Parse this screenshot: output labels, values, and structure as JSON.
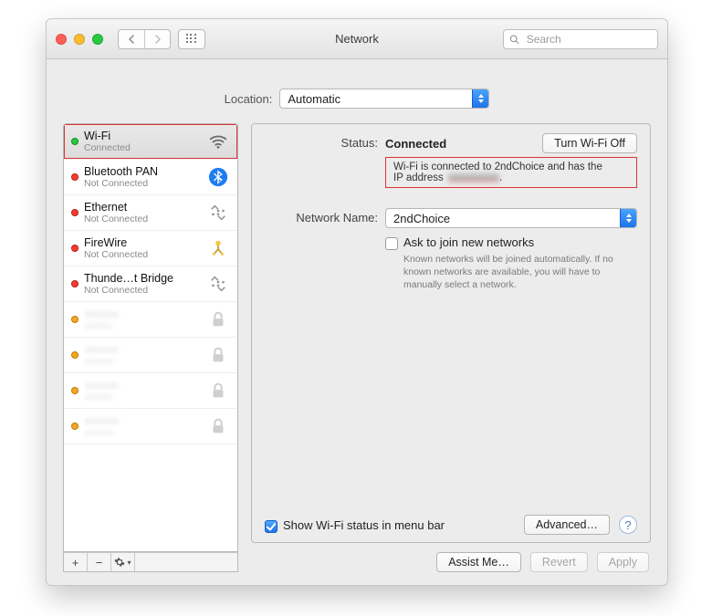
{
  "window": {
    "title": "Network"
  },
  "toolbar": {
    "search_placeholder": "Search"
  },
  "location": {
    "label": "Location:",
    "value": "Automatic"
  },
  "sidebar": {
    "items": [
      {
        "name": "Wi-Fi",
        "status": "Connected",
        "dot": "green",
        "icon": "wifi",
        "selected": true,
        "outlined": true
      },
      {
        "name": "Bluetooth PAN",
        "status": "Not Connected",
        "dot": "red",
        "icon": "bluetooth"
      },
      {
        "name": "Ethernet",
        "status": "Not Connected",
        "dot": "red",
        "icon": "ethernet"
      },
      {
        "name": "FireWire",
        "status": "Not Connected",
        "dot": "red",
        "icon": "firewire"
      },
      {
        "name": "Thunde…t Bridge",
        "status": "Not Connected",
        "dot": "red",
        "icon": "ethernet"
      },
      {
        "name": "———",
        "status": "———",
        "dot": "yellow",
        "icon": "lock",
        "blurred": true
      },
      {
        "name": "———",
        "status": "———",
        "dot": "yellow",
        "icon": "lock",
        "blurred": true
      },
      {
        "name": "———",
        "status": "———",
        "dot": "yellow",
        "icon": "lock",
        "blurred": true
      },
      {
        "name": "———",
        "status": "———",
        "dot": "yellow",
        "icon": "lock",
        "blurred": true
      }
    ],
    "add": "+",
    "remove": "−",
    "gear_caret": "▾"
  },
  "main": {
    "status_label": "Status:",
    "status_value": "Connected",
    "toggle_button": "Turn Wi-Fi Off",
    "status_detail_a": "Wi-Fi is connected to 2ndChoice and has the",
    "status_detail_b": "IP address",
    "network_name_label": "Network Name:",
    "network_name_value": "2ndChoice",
    "ask_join_label": "Ask to join new networks",
    "ask_join_checked": false,
    "ask_join_hint": "Known networks will be joined automatically. If no known networks are available, you will have to manually select a network.",
    "show_status_label": "Show Wi-Fi status in menu bar",
    "show_status_checked": true,
    "advanced_button": "Advanced…",
    "help": "?"
  },
  "actions": {
    "assist": "Assist Me…",
    "revert": "Revert",
    "apply": "Apply"
  }
}
